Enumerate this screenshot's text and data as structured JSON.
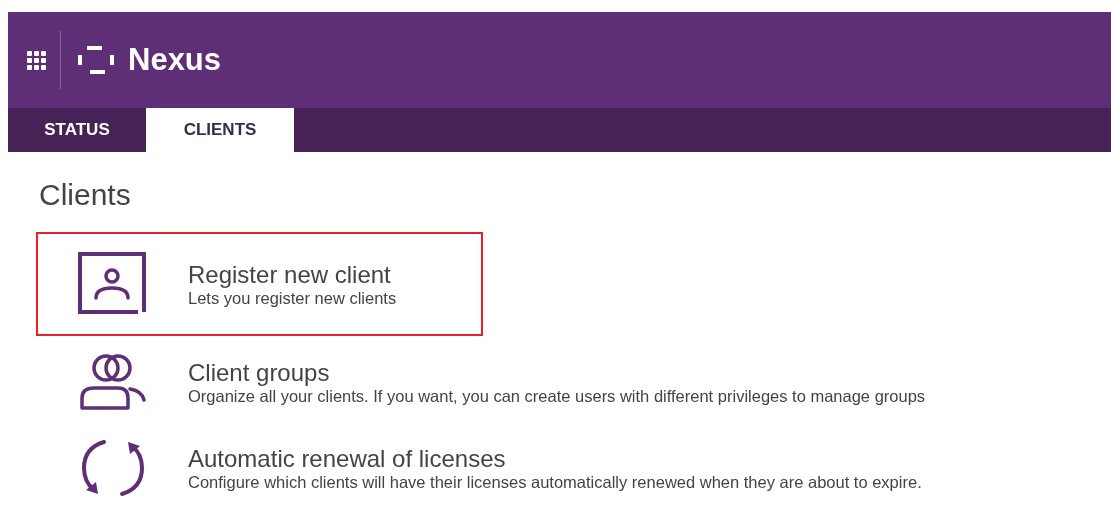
{
  "header": {
    "app_name": "Nexus"
  },
  "tabs": [
    {
      "label": "STATUS",
      "selected": false
    },
    {
      "label": "CLIENTS",
      "selected": true
    }
  ],
  "page_title": "Clients",
  "items": [
    {
      "kind": "register",
      "title": "Register new client",
      "description": "Lets you register new clients",
      "highlighted": true
    },
    {
      "kind": "groups",
      "title": "Client groups",
      "description": "Organize all your clients. If you want, you can create users with different privileges to manage groups",
      "highlighted": false
    },
    {
      "kind": "renewal",
      "title": "Automatic renewal of licenses",
      "description": "Configure which clients will have their licenses automatically renewed when they are about to expire.",
      "highlighted": false
    }
  ]
}
